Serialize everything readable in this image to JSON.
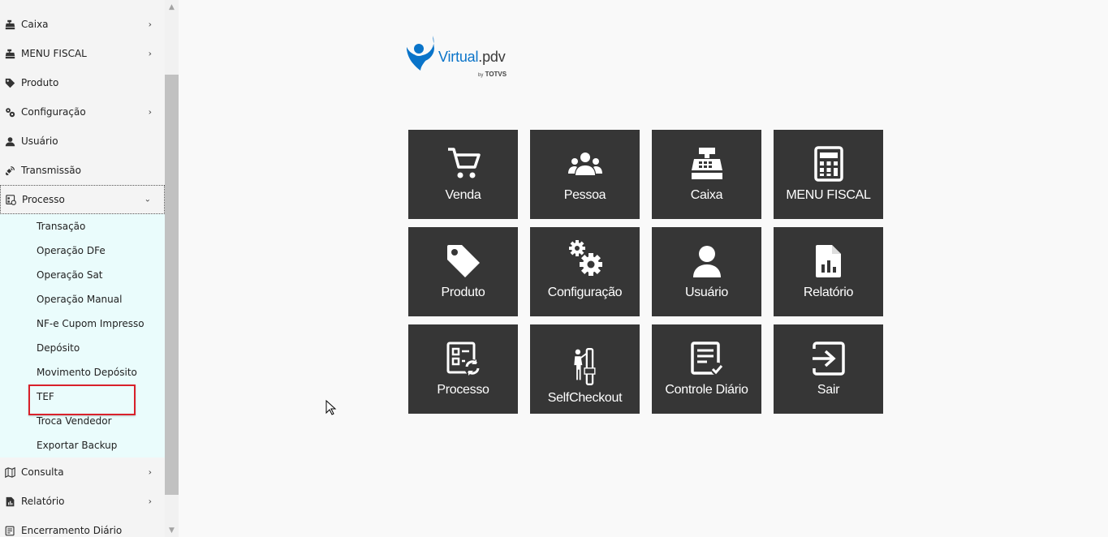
{
  "sidebar": {
    "items": [
      {
        "label": "Caixa",
        "icon": "cash-register-icon",
        "has_children": true
      },
      {
        "label": "MENU FISCAL",
        "icon": "cash-register-icon",
        "has_children": true
      },
      {
        "label": "Produto",
        "icon": "tag-icon",
        "has_children": false
      },
      {
        "label": "Configuração",
        "icon": "gears-icon",
        "has_children": true
      },
      {
        "label": "Usuário",
        "icon": "user-icon",
        "has_children": false
      },
      {
        "label": "Transmissão",
        "icon": "satellite-icon",
        "has_children": false
      },
      {
        "label": "Processo",
        "icon": "process-icon",
        "has_children": true,
        "expanded": true
      }
    ],
    "processo_submenu": [
      "Transação",
      "Operação DFe",
      "Operação Sat",
      "Operação Manual",
      "NF-e Cupom Impresso",
      "Depósito",
      "Movimento Depósito",
      "TEF",
      "Troca Vendedor",
      "Exportar Backup"
    ],
    "highlighted_submenu": "TEF",
    "bottom_items": [
      {
        "label": "Consulta",
        "icon": "map-icon",
        "has_children": true
      },
      {
        "label": "Relatório",
        "icon": "report-icon",
        "has_children": true
      },
      {
        "label": "Encerramento Diário",
        "icon": "checklist-icon",
        "has_children": false
      }
    ],
    "chevron_right": "›",
    "chevron_down": "⌄"
  },
  "logo": {
    "brand": "Virtual",
    "suffix": ".pdv",
    "by": "by",
    "company": "TOTVS"
  },
  "tiles": [
    {
      "label": "Venda",
      "icon": "cart-icon"
    },
    {
      "label": "Pessoa",
      "icon": "users-icon"
    },
    {
      "label": "Caixa",
      "icon": "cash-register-icon"
    },
    {
      "label": "MENU FISCAL",
      "icon": "calculator-icon"
    },
    {
      "label": "Produto",
      "icon": "tag-icon"
    },
    {
      "label": "Configuração",
      "icon": "gears-icon"
    },
    {
      "label": "Usuário",
      "icon": "user-icon"
    },
    {
      "label": "Relatório",
      "icon": "file-chart-icon"
    },
    {
      "label": "Processo",
      "icon": "process-icon"
    },
    {
      "label": "SelfCheckout",
      "icon": "self-checkout-icon"
    },
    {
      "label": "Controle Diário",
      "icon": "checklist-icon"
    },
    {
      "label": "Sair",
      "icon": "sign-out-icon"
    }
  ],
  "colors": {
    "tile_bg": "#363636",
    "submenu_bg": "#eafcfc",
    "highlight": "#d9212b",
    "brand_blue": "#0a74c9"
  }
}
